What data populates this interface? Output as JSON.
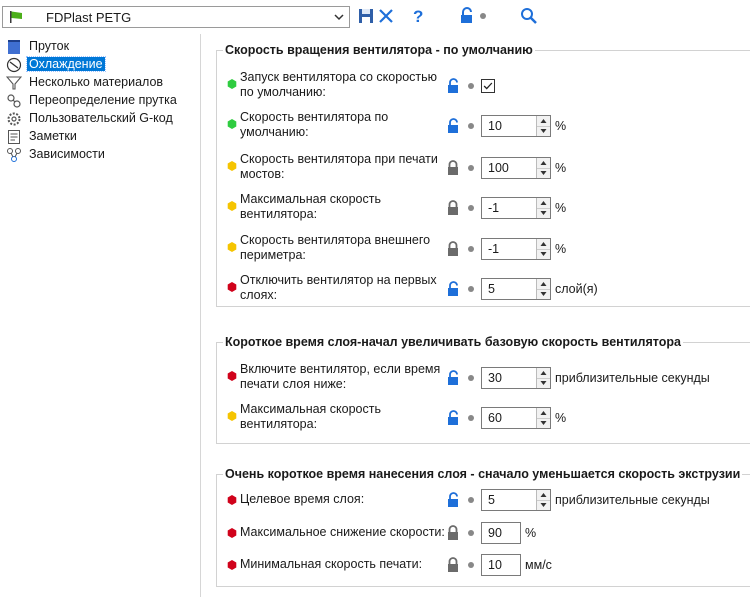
{
  "toolbar": {
    "preset_name": "FDPlast PETG",
    "icons": [
      "flag-icon",
      "chevron-down-icon",
      "save-icon",
      "close-icon",
      "help-icon",
      "lock-open-icon",
      "dot-icon",
      "search-icon"
    ]
  },
  "sidebar": {
    "items": [
      {
        "label": "Пруток",
        "icon": "spool-icon"
      },
      {
        "label": "Охлаждение",
        "icon": "fan-icon"
      },
      {
        "label": "Несколько материалов",
        "icon": "funnel-icon"
      },
      {
        "label": "Переопределение прутка",
        "icon": "wrench-icon"
      },
      {
        "label": "Пользовательский G-код",
        "icon": "gear-icon"
      },
      {
        "label": "Заметки",
        "icon": "note-icon"
      },
      {
        "label": "Зависимости",
        "icon": "dependency-icon"
      }
    ],
    "active_index": 1
  },
  "colors": {
    "green": "#2ecc40",
    "yellow": "#f5c400",
    "red": "#d0021b",
    "accent": "#0078d7",
    "lock_blue": "#1e6fd9",
    "lock_gray": "#6b6b6b"
  },
  "groups": [
    {
      "title": "Скорость вращения вентилятора - по умолчанию",
      "rows": [
        {
          "line1": "Запуск вентилятора со скоростью",
          "line2": "по умолчанию:",
          "mode": "green",
          "lock": "open",
          "type": "checkbox",
          "checked": true
        },
        {
          "line1": "Скорость вентилятора по",
          "line2": "умолчанию:",
          "mode": "green",
          "lock": "open",
          "type": "spin",
          "value": "10",
          "unit": "%"
        },
        {
          "line1": "Скорость вентилятора при печати",
          "line2": "мостов:",
          "mode": "yellow",
          "lock": "closed",
          "type": "spin",
          "value": "100",
          "unit": "%"
        },
        {
          "line1": "Максимальная скорость",
          "line2": "вентилятора:",
          "mode": "yellow",
          "lock": "closed",
          "type": "spin",
          "value": "-1",
          "unit": "%"
        },
        {
          "line1": "Скорость вентилятора внешнего",
          "line2": "периметра:",
          "mode": "yellow",
          "lock": "closed",
          "type": "spin",
          "value": "-1",
          "unit": "%"
        },
        {
          "line1": "Отключить вентилятор на первых",
          "line2": "слоях:",
          "mode": "red",
          "lock": "open",
          "type": "spin",
          "value": "5",
          "unit": "слой(я)"
        }
      ]
    },
    {
      "title": "Короткое время слоя-начал увеличивать базовую скорость вентилятора",
      "rows": [
        {
          "line1": "Включите вентилятор, если время",
          "line2": "печати слоя ниже:",
          "mode": "red",
          "lock": "open",
          "type": "spin",
          "value": "30",
          "unit": "приблизительные секунды"
        },
        {
          "line1": "Максимальная скорость",
          "line2": "вентилятора:",
          "mode": "yellow",
          "lock": "open",
          "type": "spin",
          "value": "60",
          "unit": "%"
        }
      ]
    },
    {
      "title": "Очень короткое время нанесения слоя - сначало уменьшается скорость экструзии",
      "rows": [
        {
          "line1": "Целевое время слоя:",
          "line2": "",
          "mode": "red",
          "lock": "open",
          "type": "spin",
          "value": "5",
          "unit": "приблизительные секунды"
        },
        {
          "line1": "Максимальное снижение скорости:",
          "line2": "",
          "mode": "red",
          "lock": "closed",
          "type": "plain",
          "value": "90",
          "unit": "%"
        },
        {
          "line1": "Минимальная скорость печати:",
          "line2": "",
          "mode": "red",
          "lock": "closed",
          "type": "plain",
          "value": "10",
          "unit": "мм/с"
        }
      ]
    }
  ]
}
